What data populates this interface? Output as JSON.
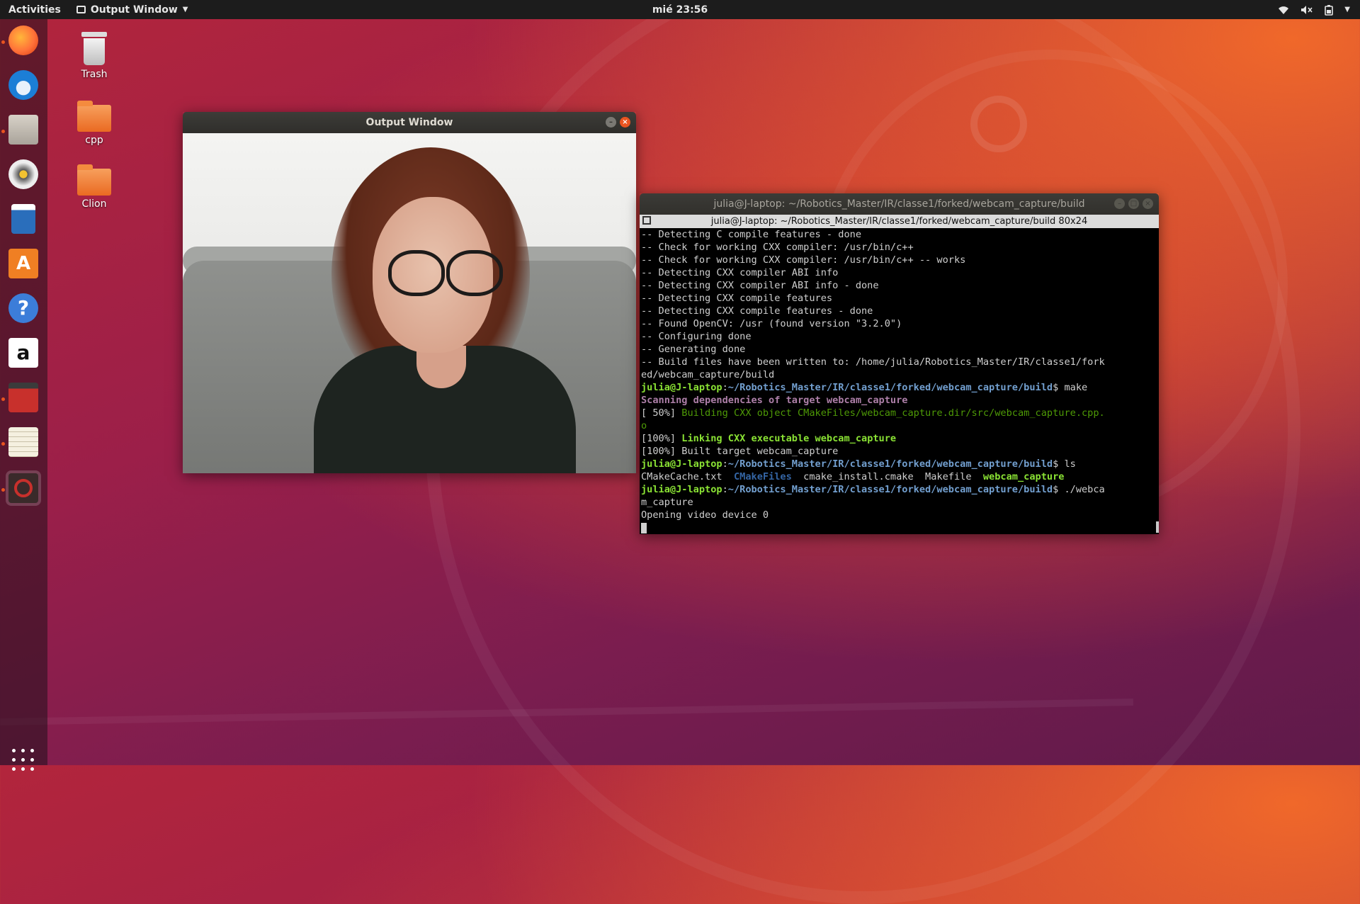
{
  "topbar": {
    "activities": "Activities",
    "app_menu": "Output Window",
    "clock": "mié 23:56",
    "tray": [
      "wifi-icon",
      "volume-muted-icon",
      "battery-icon",
      "system-menu-caret-icon"
    ]
  },
  "dock": {
    "items": [
      {
        "name": "firefox",
        "icon": "firefox-icon",
        "running": true,
        "color": "#ff7139"
      },
      {
        "name": "thunderbird",
        "icon": "thunderbird-icon",
        "running": false,
        "color": "#1c7ed6"
      },
      {
        "name": "files",
        "icon": "files-icon",
        "running": true,
        "color": "#d0c8bd"
      },
      {
        "name": "rhythmbox",
        "icon": "rhythmbox-icon",
        "running": false,
        "color": "#f2c230"
      },
      {
        "name": "libreoffice-writer",
        "icon": "writer-icon",
        "running": false,
        "color": "#2a6ebb"
      },
      {
        "name": "ubuntu-software",
        "icon": "software-icon",
        "running": false,
        "color": "#f07f23"
      },
      {
        "name": "help",
        "icon": "help-icon",
        "running": false,
        "color": "#3c7dd9"
      },
      {
        "name": "amazon",
        "icon": "amazon-icon",
        "running": false,
        "color": "#ffffff"
      },
      {
        "name": "terminal-emulator",
        "icon": "terminal-icon",
        "running": true,
        "color": "#c8302c"
      },
      {
        "name": "text-editor",
        "icon": "text-editor-icon",
        "running": true,
        "color": "#f5f0e0"
      },
      {
        "name": "output-window-app",
        "icon": "no-entry-icon",
        "running": true,
        "color": "#c8302c"
      }
    ],
    "show_apps_icon": "app-grid-icon"
  },
  "desktop": {
    "icons": [
      {
        "label": "Trash",
        "icon": "trash-icon"
      },
      {
        "label": "cpp",
        "icon": "folder-icon"
      },
      {
        "label": "Clion",
        "icon": "folder-icon"
      }
    ]
  },
  "output_window": {
    "title": "Output Window"
  },
  "terminal": {
    "title": "julia@J-laptop: ~/Robotics_Master/IR/classe1/forked/webcam_capture/build",
    "subtitle": "julia@J-laptop: ~/Robotics_Master/IR/classe1/forked/webcam_capture/build 80x24",
    "lines": [
      [
        {
          "t": "-- Detecting C compile features - done",
          "c": ""
        }
      ],
      [
        {
          "t": "-- Check for working CXX compiler: /usr/bin/c++",
          "c": ""
        }
      ],
      [
        {
          "t": "-- Check for working CXX compiler: /usr/bin/c++ -- works",
          "c": ""
        }
      ],
      [
        {
          "t": "-- Detecting CXX compiler ABI info",
          "c": ""
        }
      ],
      [
        {
          "t": "-- Detecting CXX compiler ABI info - done",
          "c": ""
        }
      ],
      [
        {
          "t": "-- Detecting CXX compile features",
          "c": ""
        }
      ],
      [
        {
          "t": "-- Detecting CXX compile features - done",
          "c": ""
        }
      ],
      [
        {
          "t": "-- Found OpenCV: /usr (found version \"3.2.0\")",
          "c": ""
        }
      ],
      [
        {
          "t": "-- Configuring done",
          "c": ""
        }
      ],
      [
        {
          "t": "-- Generating done",
          "c": ""
        }
      ],
      [
        {
          "t": "-- Build files have been written to: /home/julia/Robotics_Master/IR/classe1/fork",
          "c": ""
        }
      ],
      [
        {
          "t": "ed/webcam_capture/build",
          "c": ""
        }
      ],
      [
        {
          "t": "julia@J-laptop",
          "c": "g"
        },
        {
          "t": ":",
          "c": ""
        },
        {
          "t": "~/Robotics_Master/IR/classe1/forked/webcam_capture/build",
          "c": "b"
        },
        {
          "t": "$ make",
          "c": ""
        }
      ],
      [
        {
          "t": "Scanning dependencies of target webcam_capture",
          "c": "m"
        }
      ],
      [
        {
          "t": "[ 50%] ",
          "c": ""
        },
        {
          "t": "Building CXX object CMakeFiles/webcam_capture.dir/src/webcam_capture.cpp.",
          "c": "dg"
        }
      ],
      [
        {
          "t": "o",
          "c": "dg"
        }
      ],
      [
        {
          "t": "[100%] ",
          "c": ""
        },
        {
          "t": "Linking CXX executable webcam_capture",
          "c": "g"
        }
      ],
      [
        {
          "t": "[100%] Built target webcam_capture",
          "c": ""
        }
      ],
      [
        {
          "t": "julia@J-laptop",
          "c": "g"
        },
        {
          "t": ":",
          "c": ""
        },
        {
          "t": "~/Robotics_Master/IR/classe1/forked/webcam_capture/build",
          "c": "b"
        },
        {
          "t": "$ ls",
          "c": ""
        }
      ],
      [
        {
          "t": "CMakeCache.txt  ",
          "c": ""
        },
        {
          "t": "CMakeFiles",
          "c": "bb"
        },
        {
          "t": "  cmake_install.cmake  Makefile  ",
          "c": ""
        },
        {
          "t": "webcam_capture",
          "c": "g"
        }
      ],
      [
        {
          "t": "julia@J-laptop",
          "c": "g"
        },
        {
          "t": ":",
          "c": ""
        },
        {
          "t": "~/Robotics_Master/IR/classe1/forked/webcam_capture/build",
          "c": "b"
        },
        {
          "t": "$ ./webca",
          "c": ""
        }
      ],
      [
        {
          "t": "m_capture",
          "c": ""
        }
      ],
      [
        {
          "t": "Opening video device 0",
          "c": ""
        }
      ]
    ]
  },
  "colors": {
    "accent": "#e95420",
    "topbar": "#1c1c1c",
    "terminal_bg": "#000000"
  }
}
